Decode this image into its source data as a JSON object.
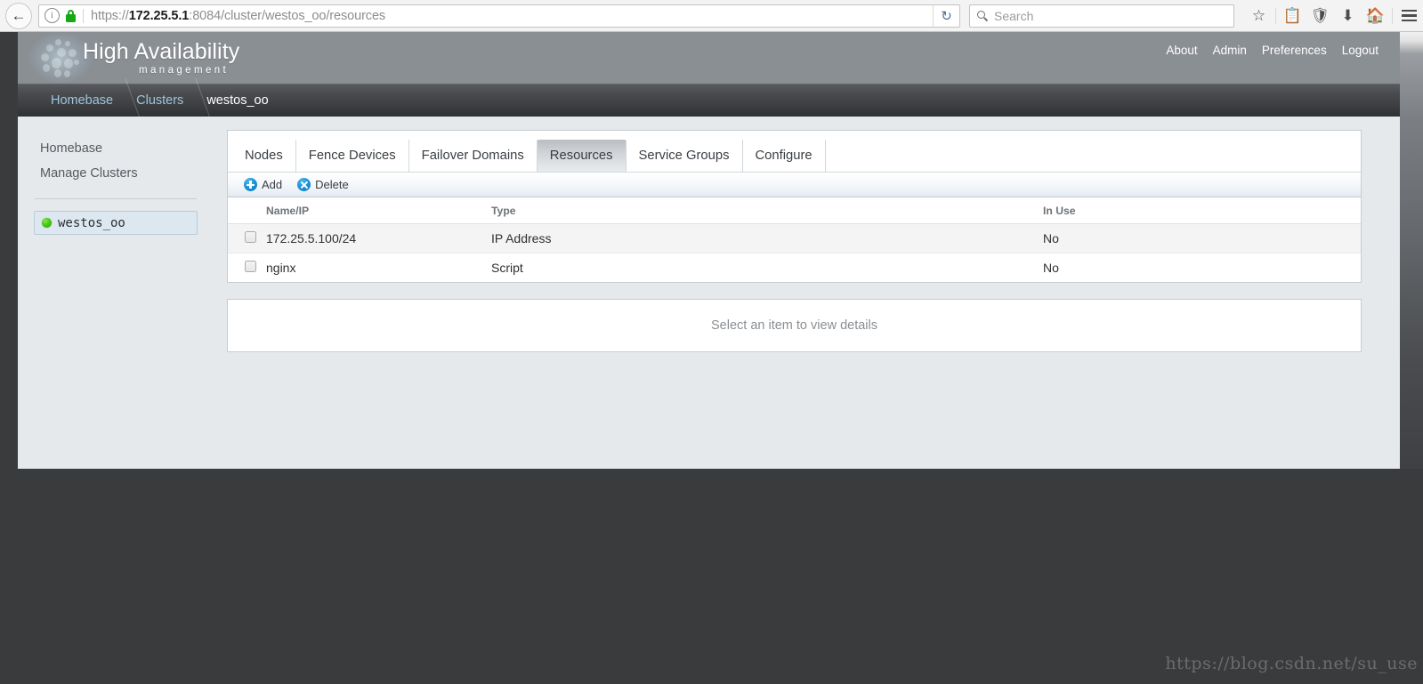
{
  "browser": {
    "back_label": "←",
    "url_scheme": "https://",
    "url_host": "172.25.5.1",
    "url_port": ":8084",
    "url_path": "/cluster/westos_oo/resources",
    "reload_label": "↻",
    "search_placeholder": "Search",
    "icons": [
      "star-icon",
      "library-icon",
      "pocket-icon",
      "downloads-icon",
      "home-icon",
      "menu-icon"
    ]
  },
  "header": {
    "title": "High Availability",
    "subtitle": "management",
    "nav": [
      {
        "label": "About"
      },
      {
        "label": "Admin"
      },
      {
        "label": "Preferences"
      },
      {
        "label": "Logout"
      }
    ]
  },
  "breadcrumb": [
    {
      "label": "Homebase",
      "current": false
    },
    {
      "label": "Clusters",
      "current": false
    },
    {
      "label": "westos_oo",
      "current": true
    }
  ],
  "sidebar": {
    "links": [
      {
        "label": "Homebase"
      },
      {
        "label": "Manage Clusters"
      }
    ],
    "clusters": [
      {
        "label": "westos_oo",
        "status": "online",
        "status_color": "#44cc11",
        "selected": true
      }
    ]
  },
  "tabs": [
    {
      "label": "Nodes",
      "active": false
    },
    {
      "label": "Fence Devices",
      "active": false
    },
    {
      "label": "Failover Domains",
      "active": false
    },
    {
      "label": "Resources",
      "active": true
    },
    {
      "label": "Service Groups",
      "active": false
    },
    {
      "label": "Configure",
      "active": false
    }
  ],
  "toolbar": {
    "add_label": "Add",
    "delete_label": "Delete"
  },
  "table": {
    "columns": [
      "Name/IP",
      "Type",
      "In Use"
    ],
    "rows": [
      {
        "checked": false,
        "name": "172.25.5.100/24",
        "type": "IP Address",
        "in_use": "No"
      },
      {
        "checked": false,
        "name": "nginx",
        "type": "Script",
        "in_use": "No"
      }
    ]
  },
  "details": {
    "empty_text": "Select an item to view details"
  },
  "watermark": {
    "text": "https://blog.csdn.net/su_use"
  },
  "colors": {
    "header_bg": "#8a8f94",
    "breadcrumb_link": "#9cc6de",
    "accent_blue": "#1a92d8",
    "page_bg": "#e6e9ec",
    "desktop_bg": "#3a3b3d",
    "status_green": "#44cc11"
  }
}
